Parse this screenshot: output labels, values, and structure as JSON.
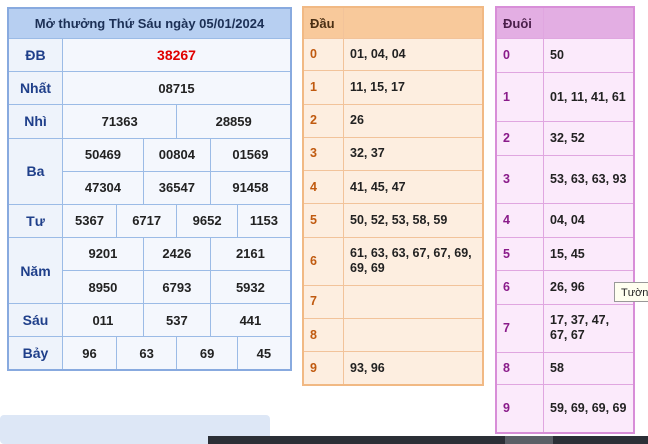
{
  "main": {
    "title": "Mở thưởng Thứ Sáu ngày 05/01/2024",
    "rows": {
      "db": {
        "label": "ĐB",
        "values": [
          "38267"
        ]
      },
      "nhat": {
        "label": "Nhất",
        "values": [
          "08715"
        ]
      },
      "nhi": {
        "label": "Nhì",
        "values": [
          "71363",
          "28859"
        ]
      },
      "ba": {
        "label": "Ba",
        "values": [
          "50469",
          "00804",
          "01569",
          "47304",
          "36547",
          "91458"
        ]
      },
      "tu": {
        "label": "Tư",
        "values": [
          "5367",
          "6717",
          "9652",
          "1153"
        ]
      },
      "nam": {
        "label": "Năm",
        "values": [
          "9201",
          "2426",
          "2161",
          "8950",
          "6793",
          "5932"
        ]
      },
      "sau": {
        "label": "Sáu",
        "values": [
          "011",
          "537",
          "441"
        ]
      },
      "bay": {
        "label": "Bảy",
        "values": [
          "96",
          "63",
          "69",
          "45"
        ]
      }
    }
  },
  "dau": {
    "header": "Đầu",
    "rows": [
      {
        "k": "0",
        "v": "01, 04, 04"
      },
      {
        "k": "1",
        "v": "11, 15, 17"
      },
      {
        "k": "2",
        "v": "26"
      },
      {
        "k": "3",
        "v": "32, 37"
      },
      {
        "k": "4",
        "v": "41, 45, 47"
      },
      {
        "k": "5",
        "v": "50, 52, 53, 58, 59"
      },
      {
        "k": "6",
        "v": "61, 63, 63, 67, 67, 69, 69, 69"
      },
      {
        "k": "7",
        "v": ""
      },
      {
        "k": "8",
        "v": ""
      },
      {
        "k": "9",
        "v": "93, 96"
      }
    ]
  },
  "duoi": {
    "header": "Đuôi",
    "rows": [
      {
        "k": "0",
        "v": "50"
      },
      {
        "k": "1",
        "v": "01, 11, 41, 61"
      },
      {
        "k": "2",
        "v": "32, 52"
      },
      {
        "k": "3",
        "v": "53, 63, 63, 93"
      },
      {
        "k": "4",
        "v": "04, 04"
      },
      {
        "k": "5",
        "v": "15, 45"
      },
      {
        "k": "6",
        "v": "26, 96"
      },
      {
        "k": "7",
        "v": "17, 37, 47, 67, 67"
      },
      {
        "k": "8",
        "v": "58"
      },
      {
        "k": "9",
        "v": "59, 69, 69, 69"
      }
    ]
  },
  "tooltip": {
    "text": "Tườn"
  },
  "colors": {
    "special_prize": "#e00000",
    "dau_accent": "#c05a10",
    "duoi_accent": "#8a1b8a",
    "main_accent": "#1f3f8a"
  }
}
